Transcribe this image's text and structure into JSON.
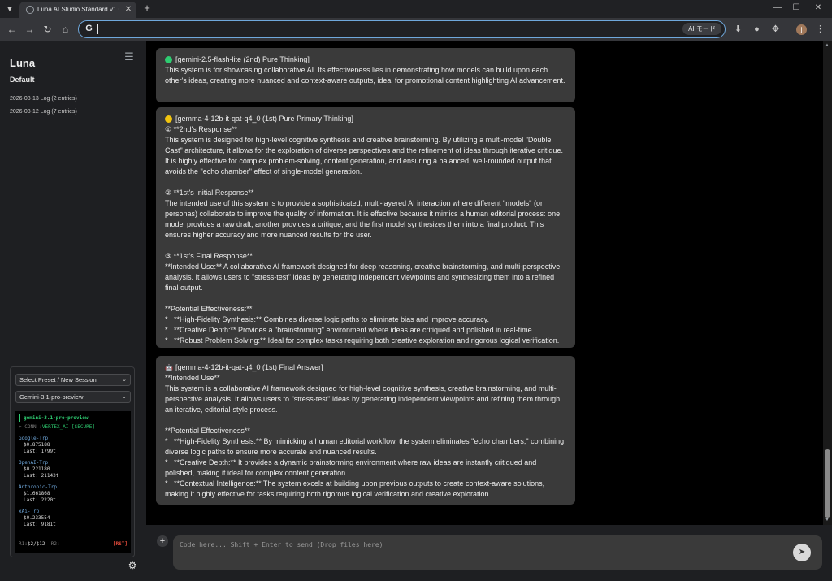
{
  "browser": {
    "tab_title": "Luna AI Studio Standard v1.0en",
    "tab_close": "✕",
    "new_tab": "+",
    "window": {
      "minimize": "—",
      "maximize": "☐",
      "close": "✕"
    },
    "address": "",
    "google_logo": "G",
    "ai_mode": "AI モード"
  },
  "sidebar": {
    "title": "Luna",
    "preset_name": "Default",
    "logs": [
      "2026-08-13 Log (2 entries)",
      "2026-08-12 Log (7 entries)"
    ],
    "preset_select": "Select Preset / New Session",
    "model_select": "Gemini-3.1-pro-preview",
    "terminal": {
      "header": "gemini-3.1-pro-preview",
      "conn_prefix": "> CONN :",
      "conn_value": "VERTEX_AI [SECURE]",
      "providers": [
        {
          "name": "Google-Trp",
          "price": "$0.875188",
          "last": "Last: 1799t"
        },
        {
          "name": "OpenAI-Trp",
          "price": "$0.221180",
          "last": "Last: 21143t"
        },
        {
          "name": "Anthropic-Trp",
          "price": "$1.661868",
          "last": "Last: 2220t"
        },
        {
          "name": "xAi-Trp",
          "price": "$0.233554",
          "last": "Last: 9181t"
        }
      ],
      "r1_label": "R1:",
      "r1_value": "$2/$12",
      "r2_label": "R2:",
      "r2_value": "----",
      "reset": "[RST]"
    }
  },
  "colors": {
    "green_dot": "#2ecc71",
    "yellow_dot": "#f1c40f",
    "accent": "#6fa8dc",
    "reset": "#e74c3c"
  },
  "icons": {
    "menu": "hamburger-icon",
    "settings": "gear-icon",
    "attach": "plus-icon",
    "send": "send-icon",
    "final": "robot-icon"
  },
  "messages": [
    {
      "header": "[gemini-2.5-flash-lite (2nd) Pure Thinking]",
      "dot": "green",
      "paragraphs": [
        "This system is for showcasing collaborative AI. Its effectiveness lies in demonstrating how models can build upon each other's ideas, creating more nuanced and context-aware outputs, ideal for promotional content highlighting AI advancement."
      ]
    },
    {
      "header": "[gemma-4-12b-it-qat-q4_0 (1st) Pure Primary Thinking]",
      "dot": "yellow",
      "paragraphs": [
        "① **2nd's Response**\nThis system is designed for high-level cognitive synthesis and creative brainstorming. By utilizing a multi-model \"Double Cast\" architecture, it allows for the exploration of diverse perspectives and the refinement of ideas through iterative critique. It is highly effective for complex problem-solving, content generation, and ensuring a balanced, well-rounded output that avoids the \"echo chamber\" effect of single-model generation.",
        "② **1st's Initial Response**\nThe intended use of this system is to provide a sophisticated, multi-layered AI interaction where different \"models\" (or personas) collaborate to improve the quality of information. It is effective because it mimics a human editorial process: one model provides a raw draft, another provides a critique, and the first model synthesizes them into a final product. This ensures higher accuracy and more nuanced results for the user.",
        "③ **1st's Final Response**\n**Intended Use:** A collaborative AI framework designed for deep reasoning, creative brainstorming, and multi-perspective analysis. It allows users to \"stress-test\" ideas by generating independent viewpoints and synthesizing them into a refined final output.",
        "**Potential Effectiveness:**\n*   **High-Fidelity Synthesis:** Combines diverse logic paths to eliminate bias and improve accuracy.\n*   **Creative Depth:** Provides a \"brainstorming\" environment where ideas are critiqued and polished in real-time.\n*   **Robust Problem Solving:** Ideal for complex tasks requiring both creative exploration and rigorous logical verification."
      ]
    },
    {
      "header": "[gemma-4-12b-it-qat-q4_0 (1st) Final Answer]",
      "dot": "robot",
      "paragraphs": [
        "**Intended Use**\nThis system is a collaborative AI framework designed for high-level cognitive synthesis, creative brainstorming, and multi-perspective analysis. It allows users to \"stress-test\" ideas by generating independent viewpoints and refining them through an iterative, editorial-style process.",
        "**Potential Effectiveness**\n*   **High-Fidelity Synthesis:** By mimicking a human editorial workflow, the system eliminates \"echo chambers,\" combining diverse logic paths to ensure more accurate and nuanced results.\n*   **Creative Depth:** It provides a dynamic brainstorming environment where raw ideas are instantly critiqued and polished, making it ideal for complex content generation.\n*   **Contextual Intelligence:** The system excels at building upon previous outputs to create context-aware solutions, making it highly effective for tasks requiring both rigorous logical verification and creative exploration."
      ]
    }
  ],
  "composer": {
    "placeholder": "Code here... Shift + Enter to send (Drop files here)",
    "value": ""
  }
}
